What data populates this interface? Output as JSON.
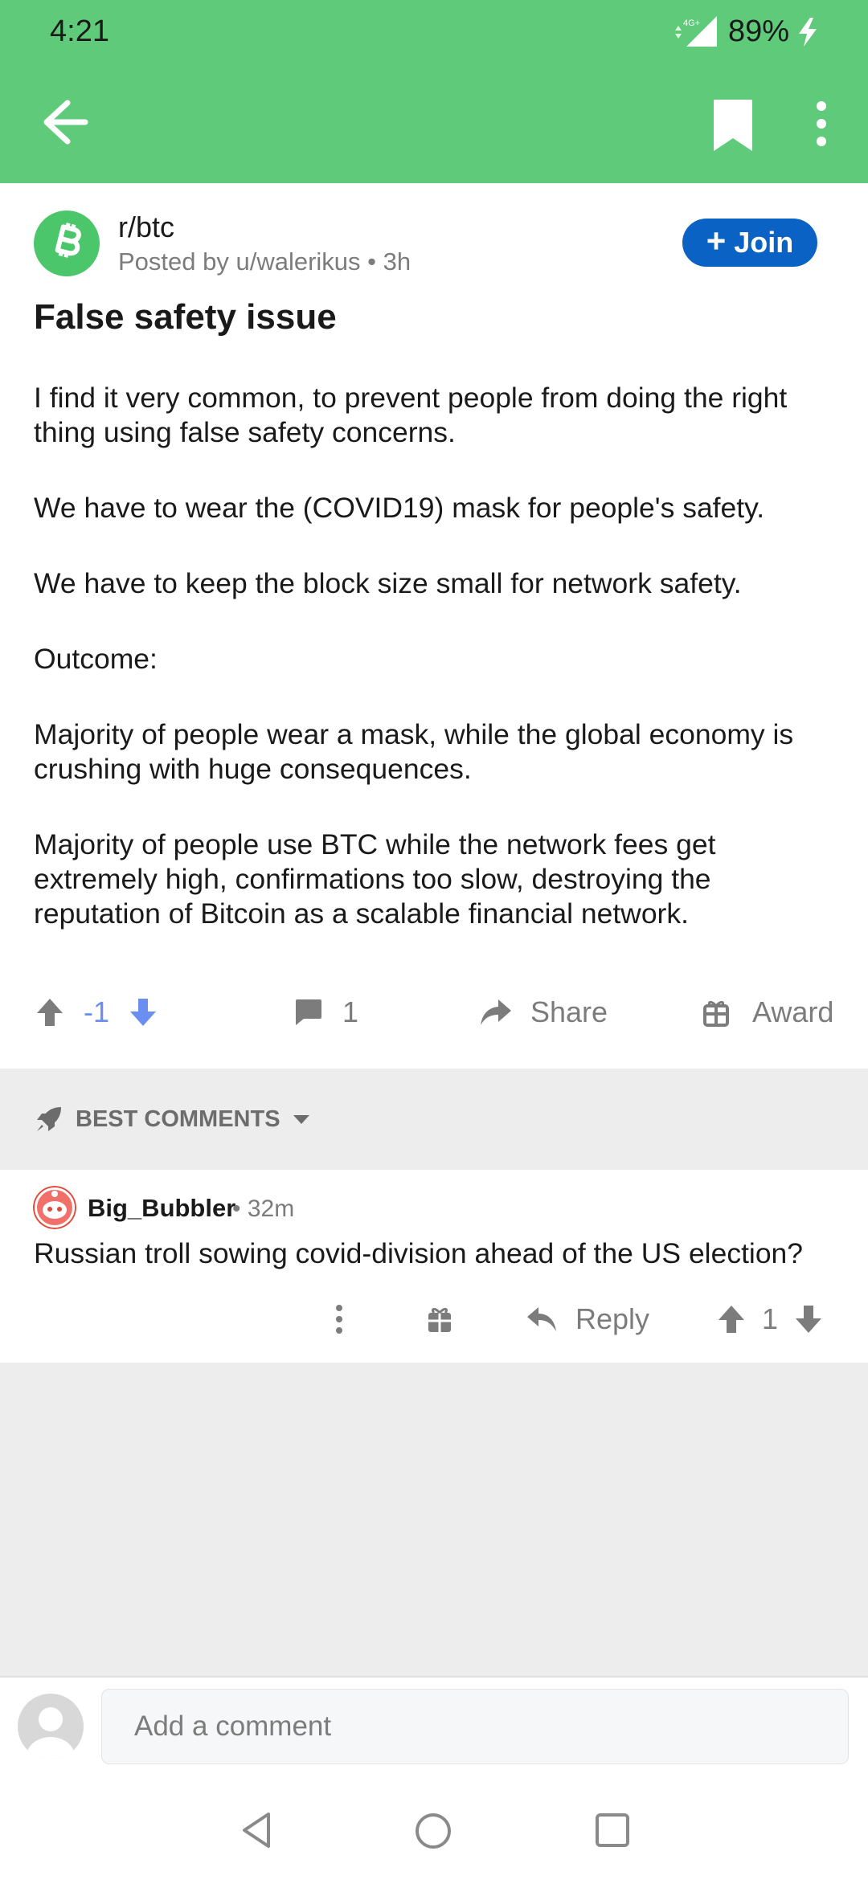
{
  "status_bar": {
    "time": "4:21",
    "network": "4G+",
    "battery": "89%"
  },
  "app_bar": {
    "back_icon": "arrow-left-icon",
    "bookmark_icon": "bookmark-icon",
    "more_icon": "more-vert-icon"
  },
  "post": {
    "subreddit": "r/btc",
    "posted_by": "Posted by u/walerikus",
    "age": "3h",
    "join_label": "Join",
    "title": "False safety issue",
    "body": [
      "I find it very common, to prevent people from doing the right thing using false safety concerns.",
      "We have to wear the (COVID19) mask for people's safety.",
      "We have to keep the block size small for network safety.",
      "Outcome:",
      "Majority of people wear a mask, while the global economy is crushing with huge consequences.",
      "Majority of people use BTC while the network fees get extremely high, confirmations too slow, destroying the reputation of Bitcoin as a scalable financial network."
    ],
    "score": "-1",
    "comment_count": "1",
    "share_label": "Share",
    "award_label": "Award"
  },
  "comments_header": {
    "sort_label": "BEST COMMENTS"
  },
  "comments": [
    {
      "author": "Big_Bubbler",
      "age": "32m",
      "text": "Russian troll sowing covid-division ahead of the US election?",
      "reply_label": "Reply",
      "score": "1"
    }
  ],
  "compose": {
    "placeholder": "Add a comment"
  },
  "colors": {
    "accent_green": "#5fcb7a",
    "join_blue": "#0a62c4",
    "downvote_blue": "#6a8ff0"
  }
}
